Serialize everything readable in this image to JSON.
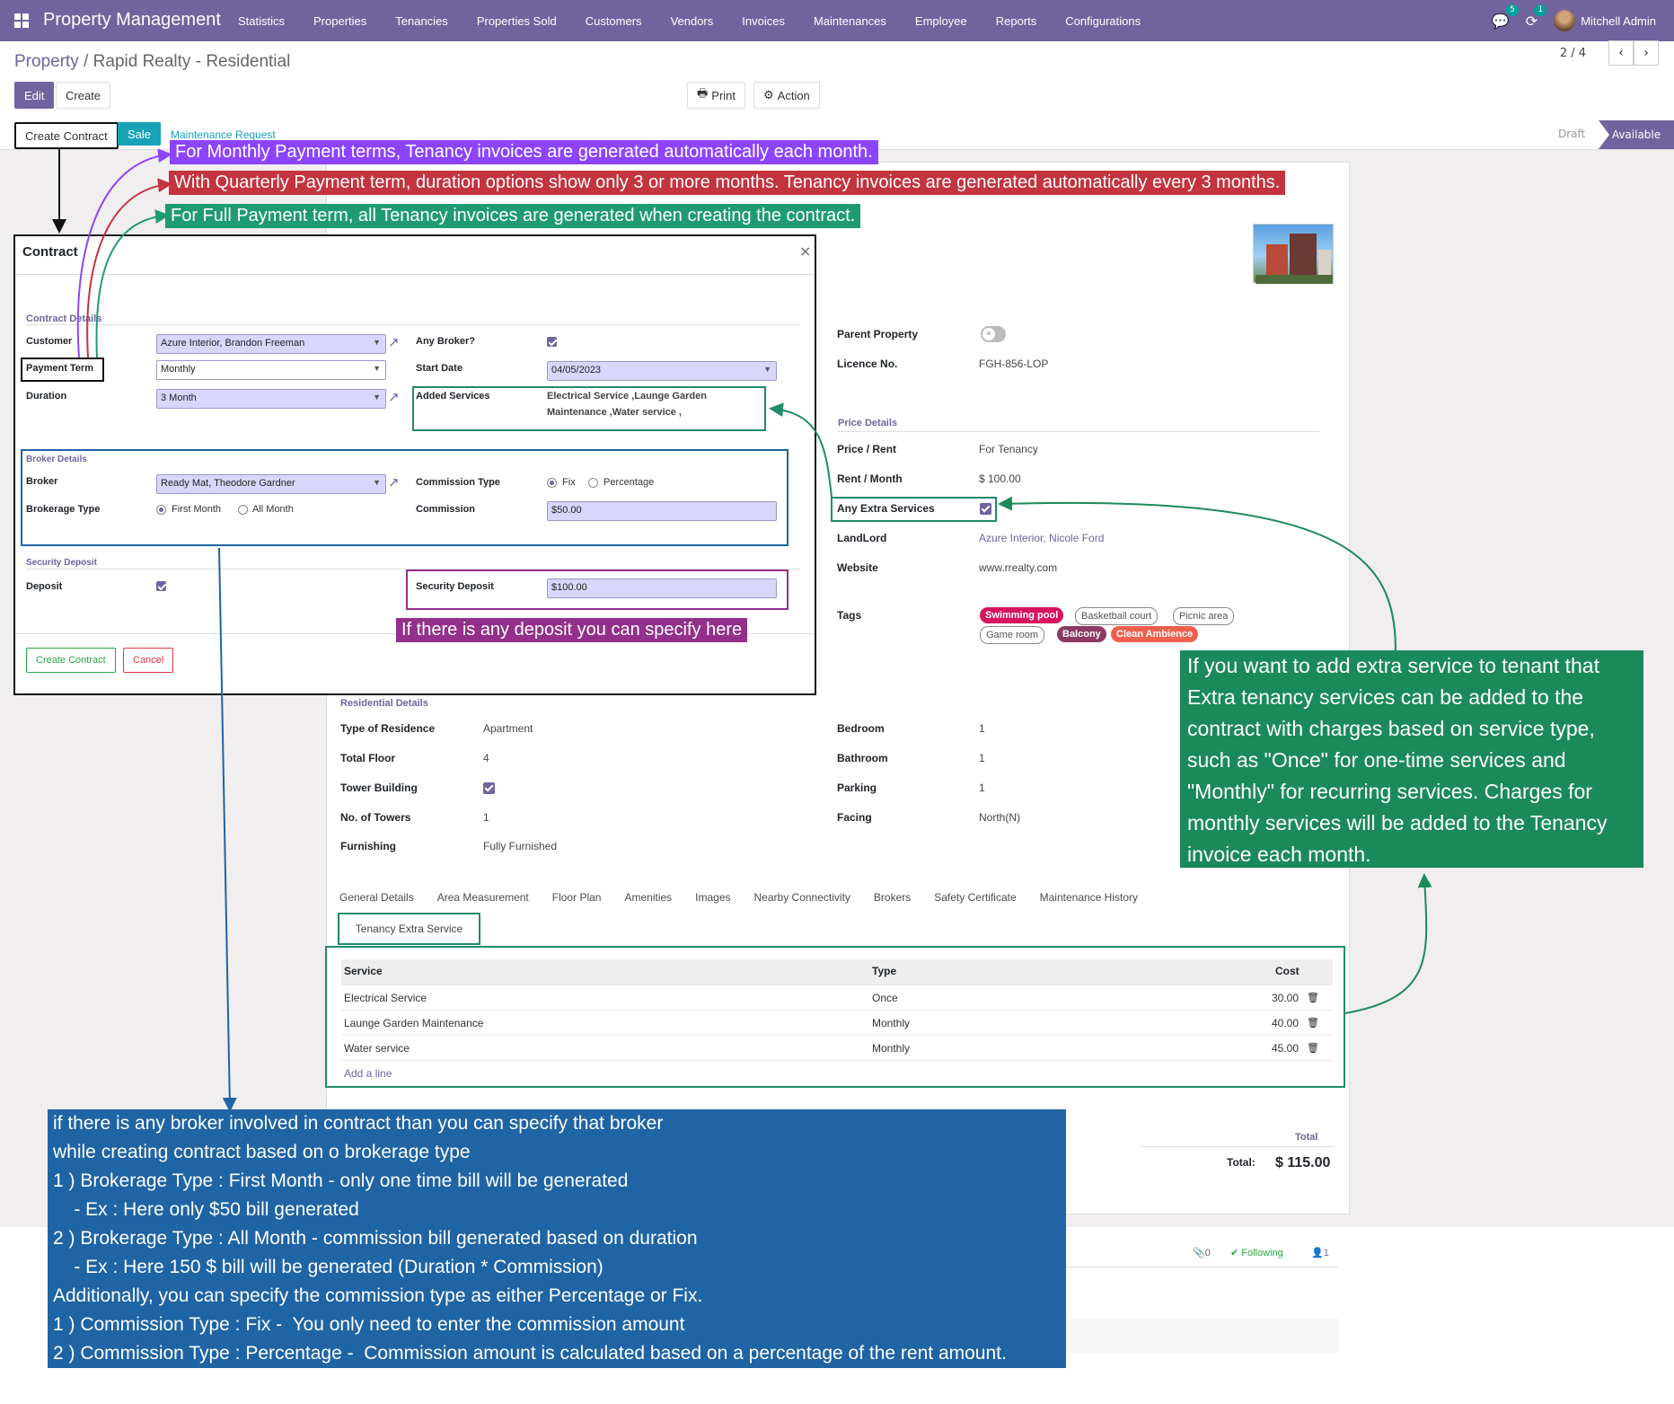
{
  "navbar": {
    "brand": "Property Management",
    "menu": [
      "Statistics",
      "Properties",
      "Tenancies",
      "Properties Sold",
      "Customers",
      "Vendors",
      "Invoices",
      "Maintenances",
      "Employee",
      "Reports",
      "Configurations"
    ],
    "chat_badge": "5",
    "activity_badge": "1",
    "user": "Mitchell Admin"
  },
  "breadcrumb": {
    "parent": "Property",
    "separator": " / ",
    "current": "Rapid Realty - Residential"
  },
  "toolbar": {
    "edit": "Edit",
    "create": "Create",
    "print": "Print",
    "action": "Action",
    "pager": "2 / 4"
  },
  "header_buttons": {
    "create_contract": "Create Contract",
    "sale": "Sale",
    "maintenance": "Maintenance Request"
  },
  "status": {
    "draft": "Draft",
    "available": "Available"
  },
  "property": {
    "parent_property_label": "Parent Property",
    "licence_label": "Licence No.",
    "licence": "FGH-856-LOP",
    "price_details": "Price Details",
    "price_rent_label": "Price / Rent",
    "price_rent": "For Tenancy",
    "rent_month_label": "Rent / Month",
    "rent_month": "$ 100.00",
    "extra_services_label": "Any Extra Services",
    "landlord_label": "LandLord",
    "landlord": "Azure Interior, Nicole Ford",
    "website_label": "Website",
    "website": "www.rrealty.com",
    "tags_label": "Tags",
    "tags": [
      {
        "name": "Swimming pool",
        "color": "#d6145f"
      },
      {
        "name": "Basketball court",
        "color": ""
      },
      {
        "name": "Picnic area",
        "color": ""
      },
      {
        "name": "Game room",
        "color": ""
      },
      {
        "name": "Balcony",
        "color": "#8b3a62"
      },
      {
        "name": "Clean Ambience",
        "color": "#f0604d"
      }
    ],
    "residential_details": "Residential Details",
    "type_label": "Type of Residence",
    "type": "Apartment",
    "floor_label": "Total Floor",
    "floor": "4",
    "tower_label": "Tower Building",
    "towers_label": "No. of Towers",
    "towers": "1",
    "furnishing_label": "Furnishing",
    "furnishing": "Fully Furnished",
    "bedroom_label": "Bedroom",
    "bedroom": "1",
    "bathroom_label": "Bathroom",
    "bathroom": "1",
    "parking_label": "Parking",
    "parking": "1",
    "facing_label": "Facing",
    "facing": "North(N)"
  },
  "tabs": [
    "General Details",
    "Area Measurement",
    "Floor Plan",
    "Amenities",
    "Images",
    "Nearby Connectivity",
    "Brokers",
    "Safety Certificate",
    "Maintenance History"
  ],
  "active_tab": "Tenancy Extra Service",
  "extra_table": {
    "headers": [
      "Service",
      "Type",
      "Cost"
    ],
    "rows": [
      {
        "service": "Electrical Service",
        "type": "Once",
        "cost": "30.00"
      },
      {
        "service": "Launge Garden Maintenance",
        "type": "Monthly",
        "cost": "40.00"
      },
      {
        "service": "Water service",
        "type": "Monthly",
        "cost": "45.00"
      }
    ],
    "add_line": "Add a line"
  },
  "totals": {
    "section": "Total",
    "label": "Total:",
    "value": "$ 115.00"
  },
  "chatter": {
    "attachments": "0",
    "following": "Following",
    "followers": "1"
  },
  "dialog": {
    "title": "Contract",
    "contract_details": "Contract Details",
    "customer_label": "Customer",
    "customer": "Azure Interior, Brandon Freeman",
    "payment_term_label": "Payment Term",
    "payment_term": "Monthly",
    "duration_label": "Duration",
    "duration": "3 Month",
    "broker_q_label": "Any Broker?",
    "start_date_label": "Start Date",
    "start_date": "04/05/2023",
    "added_services_label": "Added Services",
    "added_services_line1": "Electrical Service ,Launge Garden",
    "added_services_line2": "Maintenance ,Water service ,",
    "broker_details": "Broker Details",
    "broker_label": "Broker",
    "broker": "Ready Mat, Theodore Gardner",
    "brokerage_type_label": "Brokerage Type",
    "first_month": "First Month",
    "all_month": "All Month",
    "commission_type_label": "Commission Type",
    "fix": "Fix",
    "percentage": "Percentage",
    "commission_label": "Commission",
    "commission": "$50.00",
    "security_deposit_section": "Security Deposit",
    "deposit_label": "Deposit",
    "security_deposit_label": "Security Deposit",
    "security_deposit": "$100.00",
    "create_contract": "Create Contract",
    "cancel": "Cancel"
  },
  "annotations": {
    "monthly": "For Monthly Payment terms, Tenancy invoices are generated automatically each month.",
    "quarterly": "With Quarterly Payment term, duration options show only 3 or more months. Tenancy invoices are generated automatically every 3 months.",
    "full": "For Full Payment term, all Tenancy invoices are generated when creating the contract.",
    "deposit": "If there is any deposit you can specify here",
    "extra_service": "If you want to add extra service to tenant that Extra tenancy services can be added to the contract with charges based on service type, such as \"Once\" for one-time services and \"Monthly\" for recurring services. Charges for monthly services will be added to the Tenancy invoice each month.",
    "broker": "if there is any broker involved in contract than you can specify that broker\nwhile creating contract based on o brokerage type\n1 ) Brokerage Type : First Month - only one time bill will be generated\n    - Ex : Here only $50 bill generated\n2 ) Brokerage Type : All Month - commission bill generated based on duration\n    - Ex : Here 150 $ bill will be generated (Duration * Commission)\nAdditionally, you can specify the commission type as either Percentage or Fix.\n1 ) Commission Type : Fix -  You only need to enter the commission amount\n2 ) Commission Type : Percentage -  Commission amount is calculated based on a percentage of the rent amount."
  }
}
